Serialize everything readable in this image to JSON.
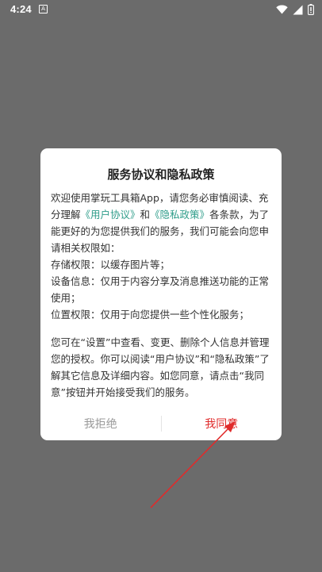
{
  "status_bar": {
    "time": "4:24",
    "notification_icon": "A"
  },
  "dialog": {
    "title": "服务协议和隐私政策",
    "intro_1": "欢迎使用掌玩工具箱App，请您务必审慎阅读、充分理解",
    "link_user_agreement": "《用户协议》",
    "and_word": "和",
    "link_privacy_policy": "《隐私政策》",
    "intro_2": "各条款，为了能更好的为您提供我们的服务，我们可能会向您申请相关权限如：",
    "perm_storage": "存储权限：以缓存图片等；",
    "perm_device": "设备信息：仅用于内容分享及消息推送功能的正常使用；",
    "perm_location": "位置权限：仅用于向您提供一些个性化服务；",
    "notice": "您可在“设置”中查看、变更、删除个人信息并管理您的授权。你可以阅读“用户协议”和“隐私政策”了解其它信息及详细内容。如您同意，请点击“我同意”按钮并开始接受我们的服务。",
    "reject_label": "我拒绝",
    "agree_label": "我同意"
  },
  "colors": {
    "overlay": "#6b6b6b",
    "link": "#2f9d8a",
    "agree": "#e02b2b",
    "annotation_arrow": "#e02b2b"
  },
  "icons": [
    "wifi-icon",
    "signal-icon",
    "battery-icon"
  ]
}
